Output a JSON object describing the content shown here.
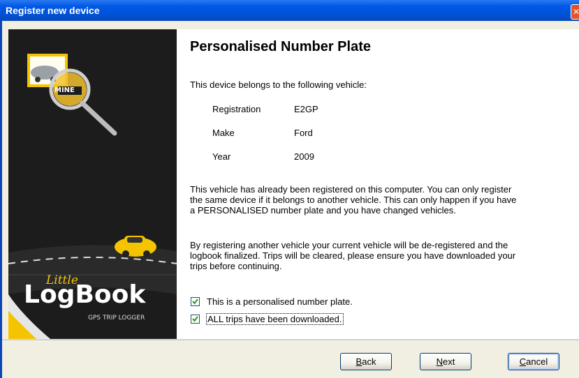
{
  "window": {
    "title": "Register new device",
    "close_glyph": "✕"
  },
  "sidebar": {
    "badge": "MINE",
    "brand_script": "Little",
    "brand_name": "LogBook",
    "brand_tagline": "GPS TRIP LOGGER"
  },
  "main": {
    "heading": "Personalised Number Plate",
    "intro": "This device belongs to the following vehicle:",
    "vehicle": {
      "registration_label": "Registration",
      "registration_value": "E2GP",
      "make_label": "Make",
      "make_value": "Ford",
      "year_label": "Year",
      "year_value": "2009"
    },
    "para1_l1": "This vehicle has already been registered on this computer. You can only register",
    "para1_l2": "the same device if it belongs to another vehicle. This can only happen if you have",
    "para1_l3": "a PERSONALISED number plate and you have changed vehicles.",
    "para2_l1": "By registering another vehicle your current vehicle will be de-registered and the",
    "para2_l2": "logbook finalized. Trips will be cleared, please ensure you have downloaded your",
    "para2_l3": "trips before continuing.",
    "checkbox1_label": "This is a personalised number plate.",
    "checkbox1_checked": true,
    "checkbox2_label": "ALL trips have been downloaded.",
    "checkbox2_checked": true
  },
  "buttons": {
    "back_u": "B",
    "back_rest": "ack",
    "next_u": "N",
    "next_rest": "ext",
    "cancel_u": "C",
    "cancel_rest": "ancel"
  },
  "colors": {
    "titlebar": "#0058e6",
    "sidebar": "#1c1c1c",
    "accent_yellow": "#f5c400"
  }
}
